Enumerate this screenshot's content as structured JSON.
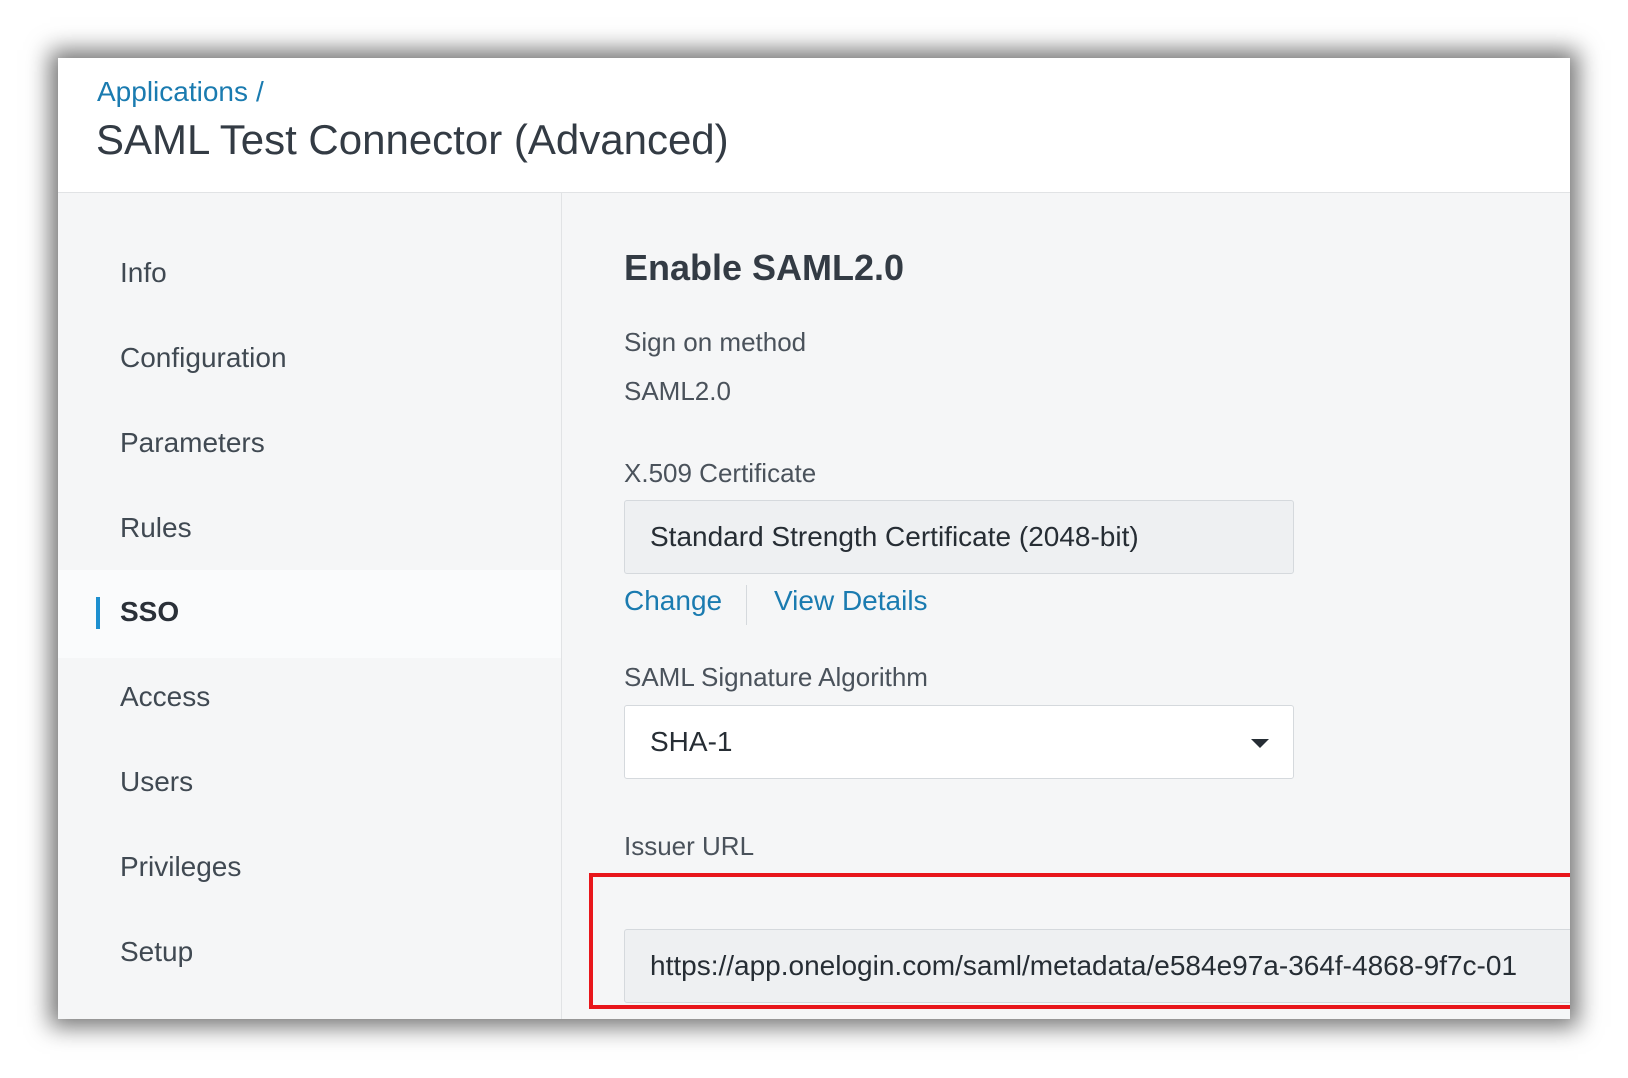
{
  "header": {
    "breadcrumb_link": "Applications",
    "breadcrumb_separator": "/",
    "title": "SAML Test Connector (Advanced)"
  },
  "sidebar": {
    "items": [
      {
        "label": "Info",
        "active": false
      },
      {
        "label": "Configuration",
        "active": false
      },
      {
        "label": "Parameters",
        "active": false
      },
      {
        "label": "Rules",
        "active": false
      },
      {
        "label": "SSO",
        "active": true
      },
      {
        "label": "Access",
        "active": false
      },
      {
        "label": "Users",
        "active": false
      },
      {
        "label": "Privileges",
        "active": false
      },
      {
        "label": "Setup",
        "active": false
      }
    ]
  },
  "main": {
    "section_title": "Enable SAML2.0",
    "sign_on": {
      "label": "Sign on method",
      "value": "SAML2.0"
    },
    "certificate": {
      "label": "X.509 Certificate",
      "value": "Standard Strength Certificate (2048-bit)",
      "change_link": "Change",
      "view_details_link": "View Details"
    },
    "signature_algorithm": {
      "label": "SAML Signature Algorithm",
      "selected": "SHA-1"
    },
    "issuer": {
      "label": "Issuer URL",
      "value": "https://app.onelogin.com/saml/metadata/e584e97a-364f-4868-9f7c-01"
    }
  },
  "colors": {
    "link": "#1a7bb0",
    "active_indicator": "#1d8fcf",
    "highlight": "#e8161b"
  }
}
